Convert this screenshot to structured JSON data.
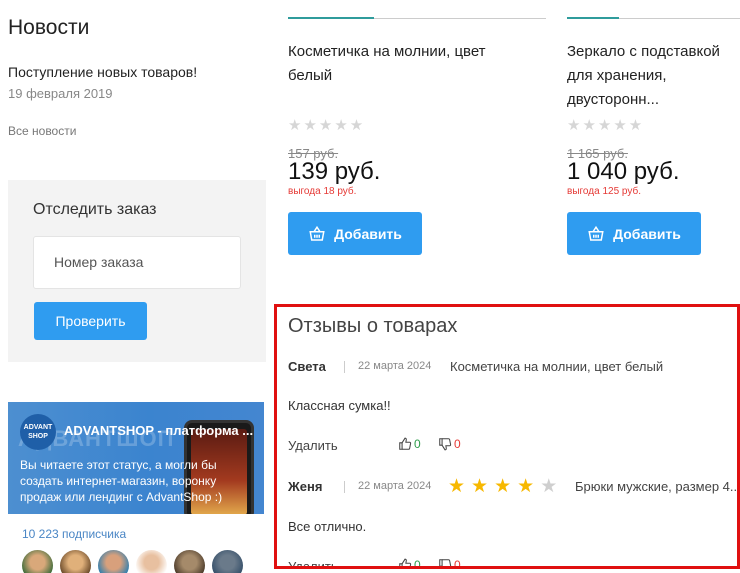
{
  "news": {
    "title": "Новости",
    "item_title": "Поступление новых товаров!",
    "item_date": "19 февраля 2019",
    "all_link": "Все новости"
  },
  "track": {
    "title": "Отследить заказ",
    "placeholder": "Номер заказа",
    "button": "Проверить"
  },
  "vk": {
    "bg_word": "АДВАНТШОП",
    "logo": "ADVANT SHOP",
    "name": "ADVANTSHOP - платформа ...",
    "text": "Вы читаете этот статус, а могли бы создать интернет-магазин, воронку продаж или лендинг с AdvantShop :)",
    "subscribers": "10 223 подписчика"
  },
  "products": [
    {
      "name": "Косметичка на молнии, цвет белый",
      "rating": 0,
      "old_price": "157 руб.",
      "price": "139 руб.",
      "discount": "выгода 18 руб.",
      "button": "Добавить"
    },
    {
      "name": "Зеркало с подставкой для хранения, двусторонн... увеличением, d зеркал...",
      "rating": 0,
      "old_price": "1 165 руб.",
      "price": "1 040 руб.",
      "discount": "выгода 125 руб.",
      "button": "Добавить"
    }
  ],
  "reviews": {
    "title": "Отзывы о товарах",
    "items": [
      {
        "author": "Света",
        "date": "22 марта 2024",
        "product": "Косметичка на молнии, цвет белый",
        "rating": 0,
        "text": "Классная сумка!!",
        "delete": "Удалить",
        "likes": "0",
        "dislikes": "0"
      },
      {
        "author": "Женя",
        "date": "22 марта 2024",
        "product": "Брюки мужские, размер 4...",
        "rating": 4,
        "text": "Все отлично.",
        "delete": "Удалить",
        "likes": "0",
        "dislikes": "0"
      }
    ]
  },
  "colors": {
    "accent": "#2f9cf0",
    "highlight_border": "#e01010",
    "star": "#f7b800",
    "discount": "#e53935",
    "like": "#2e9b4a"
  }
}
